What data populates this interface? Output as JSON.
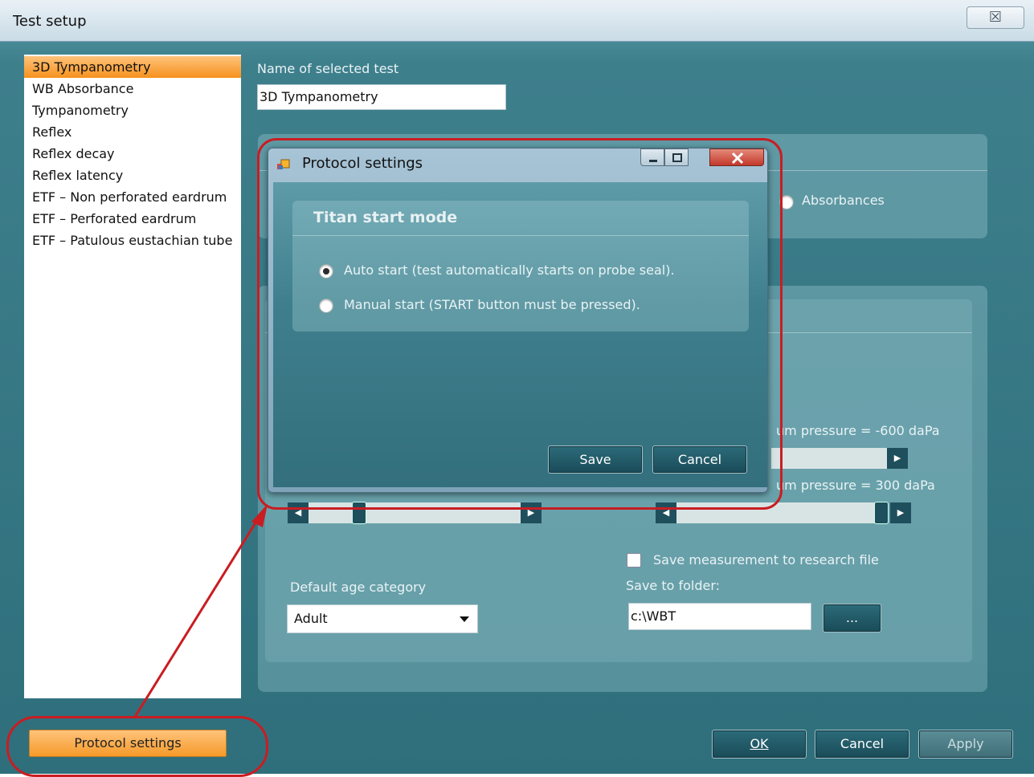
{
  "window": {
    "title": "Test setup",
    "close_glyph": "☒"
  },
  "tests": {
    "items": [
      "3D Tympanometry",
      "WB Absorbance",
      "Tympanometry",
      "Reflex",
      "Reflex decay",
      "Reflex latency",
      "ETF – Non perforated eardrum",
      "ETF – Perforated eardrum",
      "ETF – Patulous eustachian tube"
    ],
    "selected_index": 0
  },
  "main": {
    "name_label": "Name of selected test",
    "name_value": "3D Tympanometry",
    "absorbances_label": "Absorbances",
    "min_pressure_label": "um pressure = -600 daPa",
    "max_pressure_label": "um pressure = 300 daPa",
    "research_checkbox_label": "Save measurement to research file",
    "save_folder_label": "Save to folder:",
    "save_folder_value": "c:\\WBT",
    "browse_label": "...",
    "age_label": "Default age category",
    "age_value": "Adult"
  },
  "buttons": {
    "protocol_settings": "Protocol settings",
    "ok": "OK",
    "cancel": "Cancel",
    "apply": "Apply"
  },
  "dialog": {
    "title": "Protocol settings",
    "section_title": "Titan start mode",
    "options": [
      "Auto start (test automatically starts on probe seal).",
      "Manual start (START button must be pressed)."
    ],
    "selected_option": 0,
    "save_label": "Save",
    "cancel_label": "Cancel"
  },
  "colors": {
    "accent_orange": "#f6921e",
    "annotation_red": "#c91d22",
    "background_teal": "#3e7f8c"
  }
}
